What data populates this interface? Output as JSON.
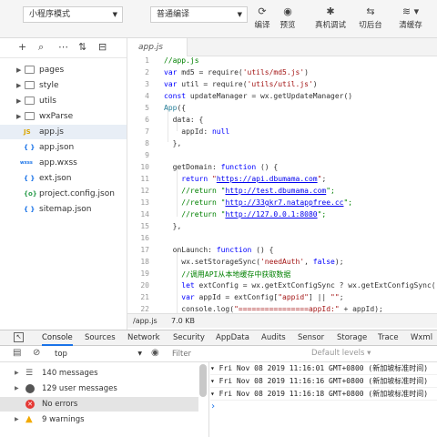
{
  "toolbar": {
    "mode_select": "小程序模式",
    "compile_select": "普通编译",
    "buttons": [
      {
        "label": "编译",
        "icon": "refresh-icon"
      },
      {
        "label": "预览",
        "icon": "eye-icon"
      },
      {
        "label": "真机调试",
        "icon": "bug-icon"
      },
      {
        "label": "切后台",
        "icon": "switch-icon"
      },
      {
        "label": "清缓存",
        "icon": "layers-icon"
      }
    ]
  },
  "sidebar": {
    "items": [
      {
        "label": "pages",
        "type": "folder"
      },
      {
        "label": "style",
        "type": "folder"
      },
      {
        "label": "utils",
        "type": "folder"
      },
      {
        "label": "wxParse",
        "type": "folder"
      },
      {
        "label": "app.js",
        "type": "js",
        "icon_text": "JS"
      },
      {
        "label": "app.json",
        "type": "json",
        "icon_text": "{ }"
      },
      {
        "label": "app.wxss",
        "type": "wxss",
        "icon_text": "wxss"
      },
      {
        "label": "ext.json",
        "type": "json",
        "icon_text": "{ }"
      },
      {
        "label": "project.config.json",
        "type": "config",
        "icon_text": "{o}"
      },
      {
        "label": "sitemap.json",
        "type": "json",
        "icon_text": "{ }"
      }
    ]
  },
  "editor": {
    "tab": "app.js",
    "line_numbers": [
      "1",
      "2",
      "3",
      "4",
      "5",
      "6",
      "7",
      "8",
      "9",
      "10",
      "11",
      "12",
      "13",
      "14",
      "15",
      "16",
      "17",
      "18",
      "19",
      "20",
      "21",
      "22"
    ],
    "status_file": "/app.js",
    "status_size": "7.0 KB"
  },
  "devtools": {
    "tabs": [
      "Console",
      "Sources",
      "Network",
      "Security",
      "AppData",
      "Audits",
      "Sensor",
      "Storage",
      "Trace",
      "Wxml"
    ],
    "context": "top",
    "filter_placeholder": "Filter",
    "levels": "Default levels ▾",
    "summary": [
      {
        "label": "140 messages",
        "icon": "list-icon",
        "color": "#555555"
      },
      {
        "label": "129 user messages",
        "icon": "user-icon",
        "color": "#555555"
      },
      {
        "label": "No errors",
        "icon": "error-icon",
        "color": "#e53935"
      },
      {
        "label": "9 warnings",
        "icon": "warning-icon",
        "color": "#f2a900"
      }
    ],
    "logs": [
      "▾ Fri Nov 08 2019 11:16:01 GMT+0800 (新加坡标准时间)",
      "▾ Fri Nov 08 2019 11:16:16 GMT+0800 (新加坡标准时间)",
      "▾ Fri Nov 08 2019 11:16:18 GMT+0800 (新加坡标准时间)"
    ],
    "prompt": "›"
  },
  "colors": {
    "keyword": "#0000ff",
    "string": "#a31515",
    "comment": "#008000",
    "url": "#0000ee",
    "accent": "#1a73e8"
  }
}
